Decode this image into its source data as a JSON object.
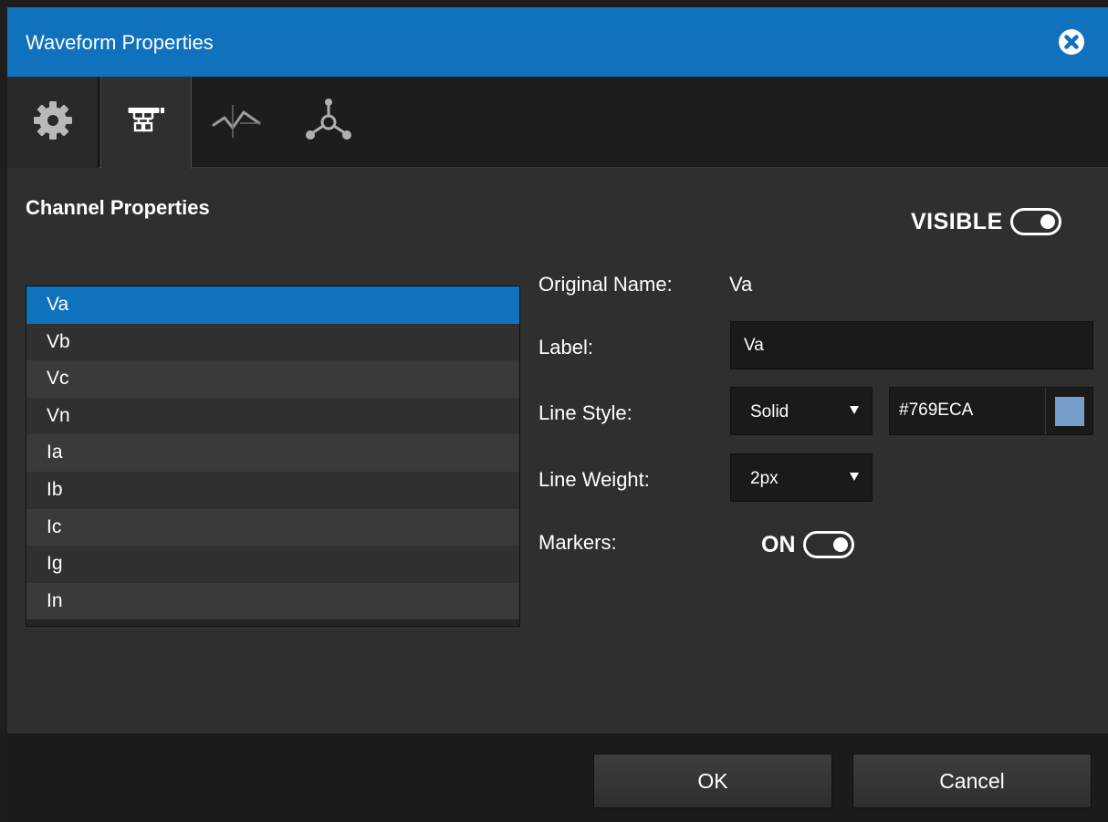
{
  "window": {
    "title": "Waveform Properties"
  },
  "tabs": [
    {
      "icon": "gear-icon"
    },
    {
      "icon": "channels-hierarchy-icon",
      "active": true
    },
    {
      "icon": "trend-line-icon"
    },
    {
      "icon": "network-nodes-icon"
    }
  ],
  "section": {
    "title": "Channel Properties"
  },
  "visible": {
    "label": "VISIBLE",
    "state": true
  },
  "channels": {
    "items": [
      "Va",
      "Vb",
      "Vc",
      "Vn",
      "Ia",
      "Ib",
      "Ic",
      "Ig",
      "In"
    ],
    "selected": "Va"
  },
  "properties": {
    "original_name_label": "Original Name:",
    "original_name_value": "Va",
    "label_label": "Label:",
    "label_value": "Va",
    "line_style_label": "Line Style:",
    "line_style_value": "Solid",
    "color_hex": "#769ECA",
    "line_weight_label": "Line Weight:",
    "line_weight_value": "2px",
    "markers_label": "Markers:",
    "markers_state_label": "ON"
  },
  "buttons": {
    "ok": "OK",
    "cancel": "Cancel"
  },
  "colors": {
    "accent": "#1071bd",
    "swatch": "#769ECA",
    "dialog_bg": "#2f2f2f"
  }
}
